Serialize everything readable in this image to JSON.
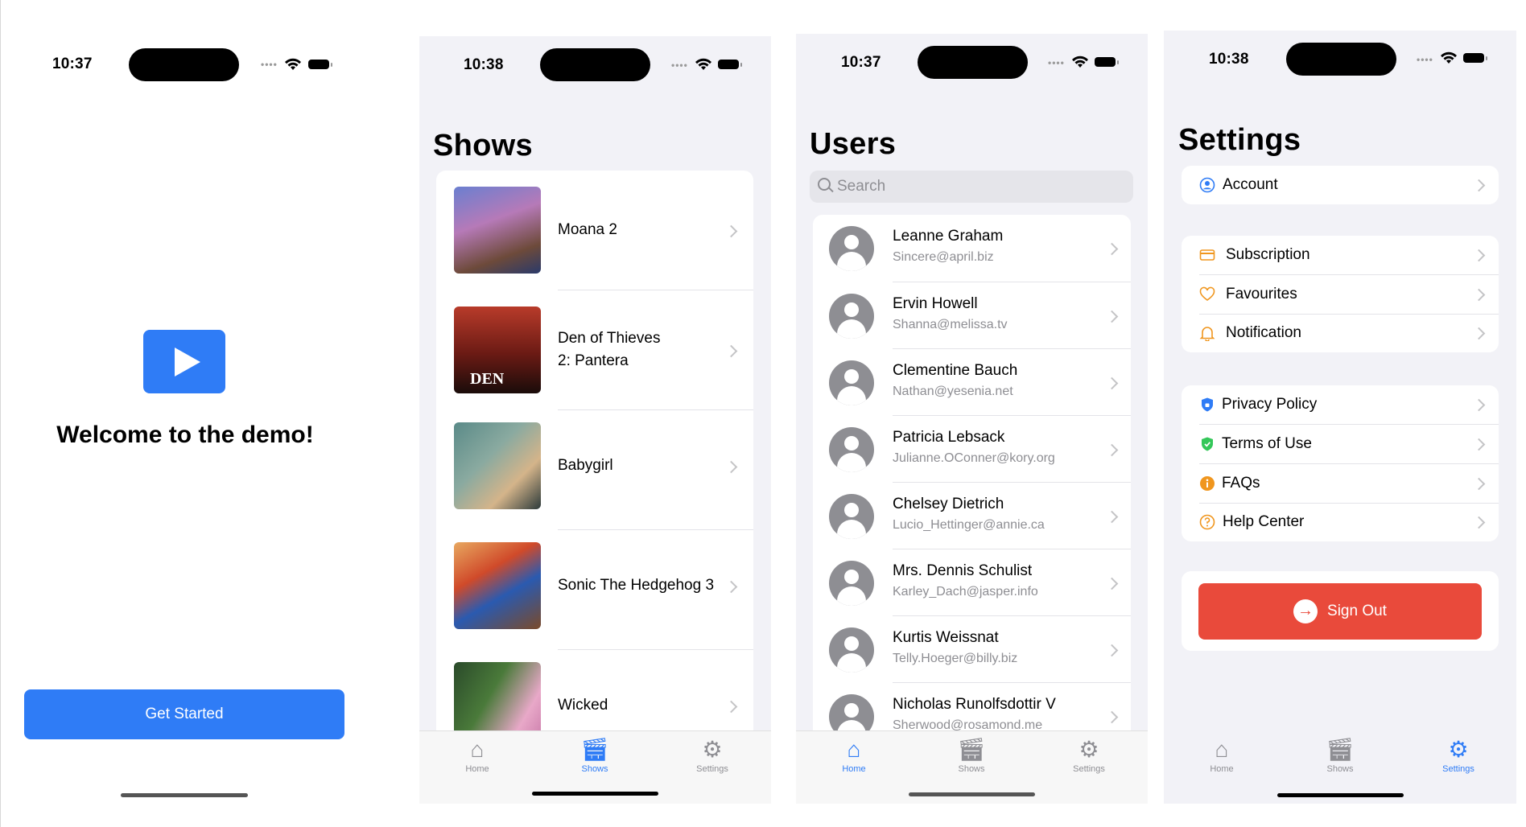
{
  "welcome_screen": {
    "time": "10:37",
    "heading": "Welcome to the demo!",
    "button": "Get Started"
  },
  "shows_screen": {
    "time": "10:38",
    "title": "Shows",
    "items": [
      {
        "title": "Moana 2"
      },
      {
        "title_line1": "Den of Thieves",
        "title_line2": "2: Pantera"
      },
      {
        "title": "Babygirl"
      },
      {
        "title": "Sonic The Hedgehog 3"
      },
      {
        "title": "Wicked"
      }
    ],
    "tabs": {
      "home": "Home",
      "shows": "Shows",
      "settings": "Settings"
    },
    "active_tab": "Shows"
  },
  "users_screen": {
    "time": "10:37",
    "title": "Users",
    "search_placeholder": "Search",
    "users": [
      {
        "name": "Leanne Graham",
        "email": "Sincere@april.biz"
      },
      {
        "name": "Ervin Howell",
        "email": "Shanna@melissa.tv"
      },
      {
        "name": "Clementine Bauch",
        "email": "Nathan@yesenia.net"
      },
      {
        "name": "Patricia Lebsack",
        "email": "Julianne.OConner@kory.org"
      },
      {
        "name": "Chelsey Dietrich",
        "email": "Lucio_Hettinger@annie.ca"
      },
      {
        "name": "Mrs. Dennis Schulist",
        "email": "Karley_Dach@jasper.info"
      },
      {
        "name": "Kurtis Weissnat",
        "email": "Telly.Hoeger@billy.biz"
      },
      {
        "name": "Nicholas Runolfsdottir V",
        "email": "Sherwood@rosamond.me"
      }
    ],
    "tabs": {
      "home": "Home",
      "shows": "Shows",
      "settings": "Settings"
    },
    "active_tab": "Home"
  },
  "settings_screen": {
    "time": "10:38",
    "title": "Settings",
    "group1": [
      {
        "label": "Account",
        "icon": "person-circle-icon"
      }
    ],
    "group2": [
      {
        "label": "Subscription",
        "icon": "credit-card-icon"
      },
      {
        "label": "Favourites",
        "icon": "heart-icon"
      },
      {
        "label": "Notification",
        "icon": "bell-icon"
      }
    ],
    "group3": [
      {
        "label": "Privacy Policy",
        "icon": "shield-icon"
      },
      {
        "label": "Terms of Use",
        "icon": "shield-check-icon"
      },
      {
        "label": "FAQs",
        "icon": "info-circle-icon"
      },
      {
        "label": "Help Center",
        "icon": "question-circle-icon"
      }
    ],
    "sign_out": "Sign Out",
    "tabs": {
      "home": "Home",
      "shows": "Shows",
      "settings": "Settings"
    },
    "active_tab": "Settings"
  },
  "colors": {
    "accent": "#2f7cf6",
    "destructive": "#e94a3b",
    "background": "#f2f2f7",
    "secondary_text": "#8e8e93"
  }
}
